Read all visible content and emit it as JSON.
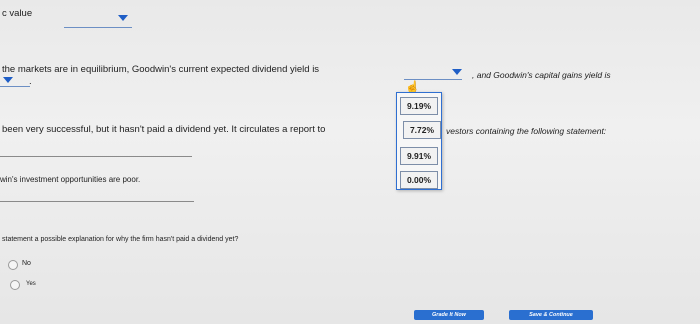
{
  "top": {
    "label_fragment": "c value"
  },
  "q1": {
    "prefix": "the markets are in equilibrium, Goodwin's current expected dividend yield is",
    "suffix": ", and Goodwin's capital gains yield is",
    "period": "."
  },
  "q2": {
    "text_left": "been very successful, but it hasn't paid a dividend yet. It circulates a report to",
    "text_right": "vestors containing the following statement:"
  },
  "dropdown": {
    "options": [
      "9.19%",
      "7.72%",
      "9.91%",
      "0.00%"
    ]
  },
  "statement": {
    "text": "win's investment opportunities are poor."
  },
  "question3": {
    "text": "statement a possible explanation for why the firm hasn't paid a dividend yet?"
  },
  "radios": {
    "options": [
      "No",
      "Yes"
    ]
  },
  "buttons": {
    "grade": "Grade It Now",
    "save": "Save & Continue"
  },
  "colors": {
    "accent": "#2a6fd0",
    "caret": "#1f5ec6"
  }
}
